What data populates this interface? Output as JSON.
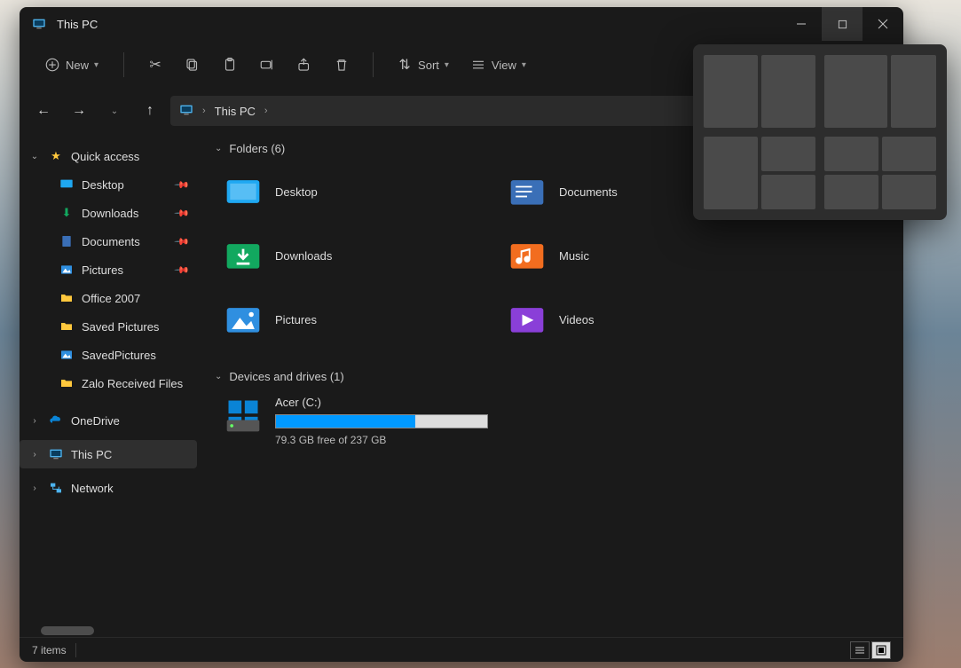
{
  "window": {
    "title": "This PC"
  },
  "toolbar": {
    "new_label": "New",
    "sort_label": "Sort",
    "view_label": "View"
  },
  "address": {
    "location": "This PC"
  },
  "sidebar": {
    "quick_access": "Quick access",
    "items": [
      {
        "label": "Desktop",
        "pinned": true
      },
      {
        "label": "Downloads",
        "pinned": true
      },
      {
        "label": "Documents",
        "pinned": true
      },
      {
        "label": "Pictures",
        "pinned": true
      },
      {
        "label": "Office 2007",
        "pinned": false
      },
      {
        "label": "Saved Pictures",
        "pinned": false
      },
      {
        "label": "SavedPictures",
        "pinned": false
      },
      {
        "label": "Zalo Received Files",
        "pinned": false
      }
    ],
    "onedrive": "OneDrive",
    "this_pc": "This PC",
    "network": "Network"
  },
  "groups": {
    "folders_header": "Folders (6)",
    "devices_header": "Devices and drives (1)"
  },
  "folders": [
    {
      "label": "Desktop",
      "color": "#1fa8f2"
    },
    {
      "label": "Documents",
      "color": "#3a6fb7"
    },
    {
      "label": "Downloads",
      "color": "#12a85f"
    },
    {
      "label": "Music",
      "color": "#f26d1f"
    },
    {
      "label": "Pictures",
      "color": "#2f8fe0"
    },
    {
      "label": "Videos",
      "color": "#8a3fd8"
    }
  ],
  "drive": {
    "label": "Acer (C:)",
    "free_text": "79.3 GB free of 237 GB",
    "fill_percent": 66
  },
  "status": {
    "items": "7 items"
  }
}
